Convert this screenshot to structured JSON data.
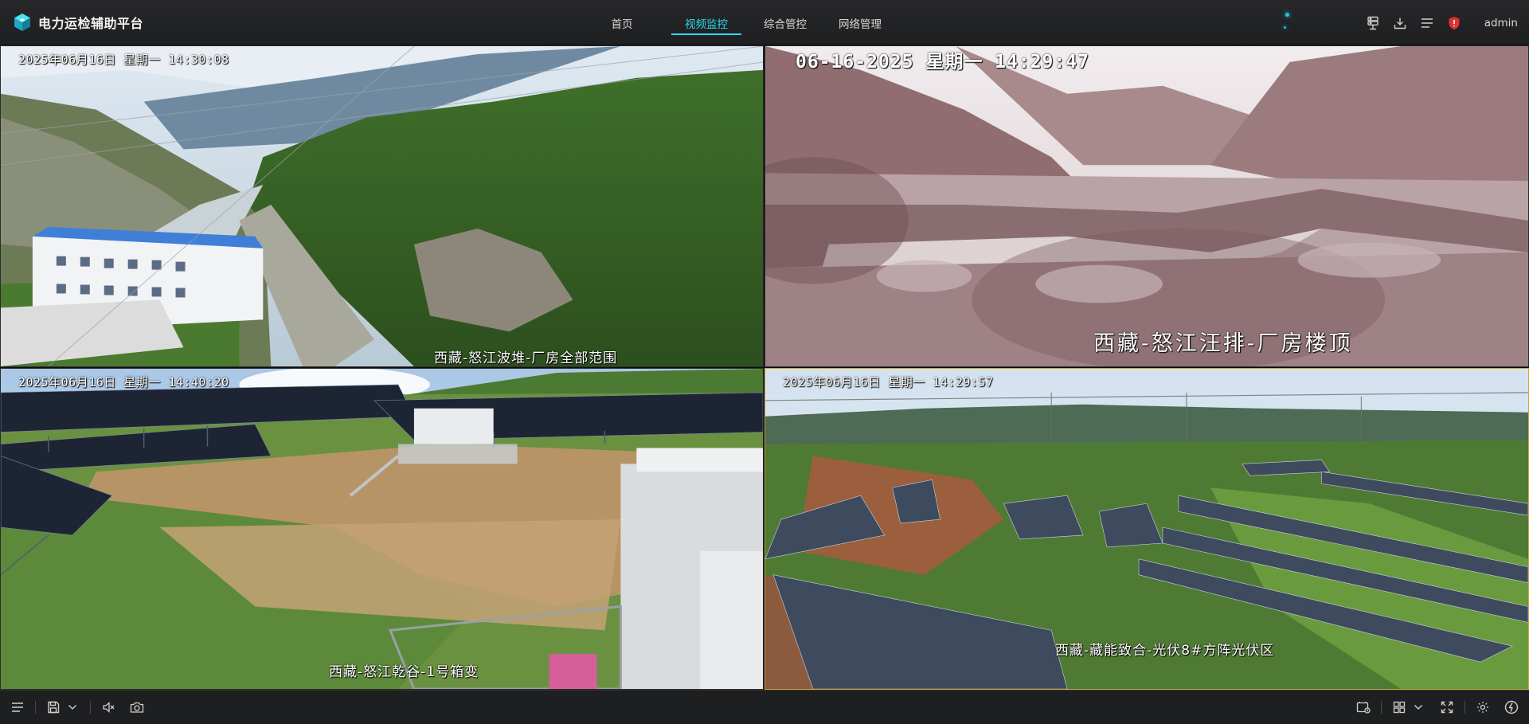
{
  "app": {
    "title": "电力运检辅助平台",
    "logo_icon": "cube-logo-icon",
    "accent_color": "#2ed8f0"
  },
  "nav": {
    "items": [
      {
        "label": "首页",
        "active": false
      },
      {
        "label": "视频监控",
        "active": true
      },
      {
        "label": "综合管控",
        "active": false
      },
      {
        "label": "网络管理",
        "active": false
      }
    ]
  },
  "toolbar": {
    "icons": [
      "server-icon",
      "download-icon",
      "list-icon",
      "alarm-shield-icon"
    ],
    "alarm_color": "#e0332e",
    "user": "admin"
  },
  "video_tiles": [
    {
      "timestamp": "2025年06月16日  星期一  14:30:08",
      "channel_name": "西藏-怒江波堆-厂房全部范围",
      "selected": false
    },
    {
      "timestamp": "06-16-2025 星期一 14:29:47",
      "channel_name": "西藏-怒江汪排-厂房楼顶",
      "selected": false
    },
    {
      "timestamp": "2025年06月16日  星期一  14:40:20",
      "channel_name": "西藏-怒江乾谷-1号箱变",
      "selected": false
    },
    {
      "timestamp": "2025年06月16日  星期一  14:29:57",
      "channel_name": "西藏-藏能致合-光伏8#方阵光伏区",
      "selected": true,
      "border_color": "#c8a33a"
    }
  ],
  "bottom_toolbar": {
    "left_icons": [
      "menu-toggle-icon",
      "save-icon",
      "chevron-down-icon",
      "mute-icon",
      "snapshot-icon"
    ],
    "right_icons": [
      "layout-switch-icon",
      "grid-layout-icon",
      "chevron-down-icon",
      "fullscreen-icon",
      "settings-icon",
      "power-icon"
    ]
  }
}
